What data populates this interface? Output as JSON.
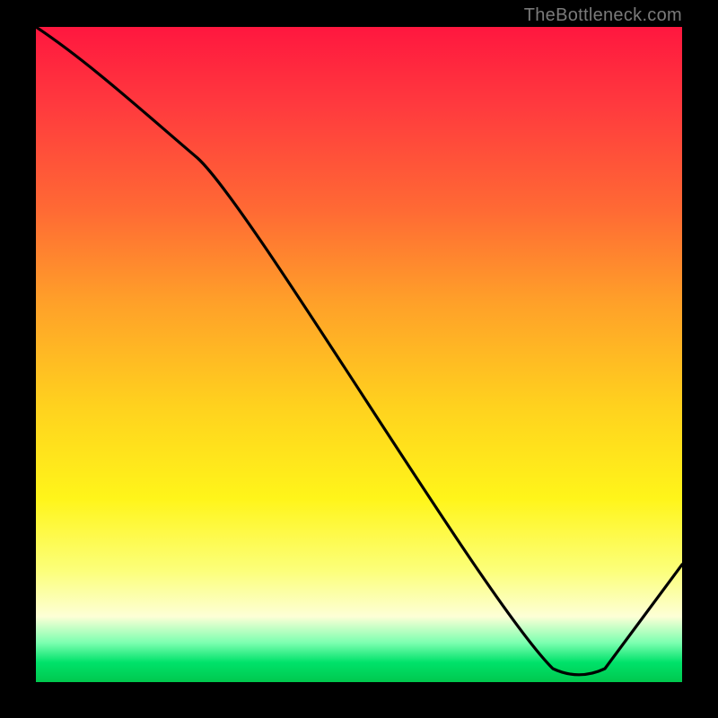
{
  "watermark": "TheBottleneck.com",
  "anchor_text": "",
  "chart_data": {
    "type": "line",
    "title": "",
    "xlabel": "",
    "ylabel": "",
    "xlim": [
      0,
      100
    ],
    "ylim": [
      0,
      100
    ],
    "grid": false,
    "series": [
      {
        "name": "curve",
        "color": "#000000",
        "x": [
          0,
          25,
          80,
          88,
          100
        ],
        "values": [
          100,
          80,
          2,
          2,
          18
        ]
      }
    ],
    "anchor": {
      "x_range": [
        78,
        90
      ],
      "y": 2,
      "label": ""
    },
    "notes": "Background is a vertical red→yellow→green gradient (bottleneck heat scale). Curve descends from top-left, kinks near x≈25, reaches a flat minimum around x≈80–88 (green zone), then rises toward x=100."
  }
}
